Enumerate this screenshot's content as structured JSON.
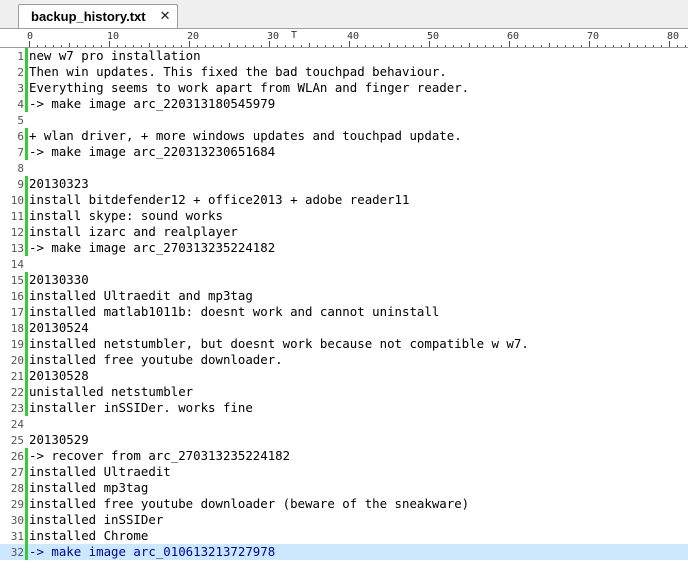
{
  "tab": {
    "title": "backup_history.txt",
    "close_glyph": "✕"
  },
  "ruler": {
    "labels": [
      "0",
      "10",
      "20",
      "30",
      "40",
      "50",
      "60",
      "70",
      "80"
    ],
    "caret_glyph": "T"
  },
  "editor": {
    "current_line": 32,
    "lines": [
      {
        "n": "1",
        "text": "new w7 pro installation",
        "changed": true
      },
      {
        "n": "2",
        "text": "Then win updates. This fixed the bad touchpad behaviour.",
        "changed": true
      },
      {
        "n": "3",
        "text": "Everything seems to work apart from WLAn and finger reader.",
        "changed": true
      },
      {
        "n": "4",
        "text": "-> make image arc_22031318054 5979",
        "changed": true
      },
      {
        "n": "5",
        "text": "",
        "changed": false
      },
      {
        "n": "6",
        "text": "+ wlan driver, + more windows updates and touchpad update.",
        "changed": true
      },
      {
        "n": "7",
        "text": "-> make image arc_220313230651684",
        "changed": true
      },
      {
        "n": "8",
        "text": "",
        "changed": false
      },
      {
        "n": "9",
        "text": "20130323",
        "changed": true
      },
      {
        "n": "10",
        "text": "install bitdefender12 + office2013 + adobe reader11",
        "changed": true
      },
      {
        "n": "11",
        "text": "install skype: sound works",
        "changed": true
      },
      {
        "n": "12",
        "text": "install izarc and realplayer",
        "changed": true
      },
      {
        "n": "13",
        "text": "-> make image arc_270313235224182",
        "changed": true
      },
      {
        "n": "14",
        "text": "",
        "changed": false
      },
      {
        "n": "15",
        "text": "20130330",
        "changed": true
      },
      {
        "n": "16",
        "text": "installed Ultraedit and mp3tag",
        "changed": true
      },
      {
        "n": "17",
        "text": "installed matlab1011b: doesnt work and cannot uninstall",
        "changed": true
      },
      {
        "n": "18",
        "text": "20130524",
        "changed": true
      },
      {
        "n": "19",
        "text": "installed netstumbler, but doesnt work because not compatible w w7.",
        "changed": true
      },
      {
        "n": "20",
        "text": "installed free youtube downloader.",
        "changed": true
      },
      {
        "n": "21",
        "text": "20130528",
        "changed": true
      },
      {
        "n": "22",
        "text": "unistalled netstumbler",
        "changed": true
      },
      {
        "n": "23",
        "text": "installer inSSIDer. works fine",
        "changed": true
      },
      {
        "n": "24",
        "text": "",
        "changed": false
      },
      {
        "n": "25",
        "text": "20130529",
        "changed": false
      },
      {
        "n": "26",
        "text": "-> recover from arc_270313235224182",
        "changed": true
      },
      {
        "n": "27",
        "text": "installed Ultraedit",
        "changed": true
      },
      {
        "n": "28",
        "text": "installed mp3tag",
        "changed": true
      },
      {
        "n": "29",
        "text": "installed free youtube downloader (beware of the sneakware)",
        "changed": true
      },
      {
        "n": "30",
        "text": "installed inSSIDer",
        "changed": true
      },
      {
        "n": "31",
        "text": "installed Chrome",
        "changed": true
      },
      {
        "n": "32",
        "text": "-> make image arc_010613213727978",
        "changed": true
      }
    ]
  }
}
